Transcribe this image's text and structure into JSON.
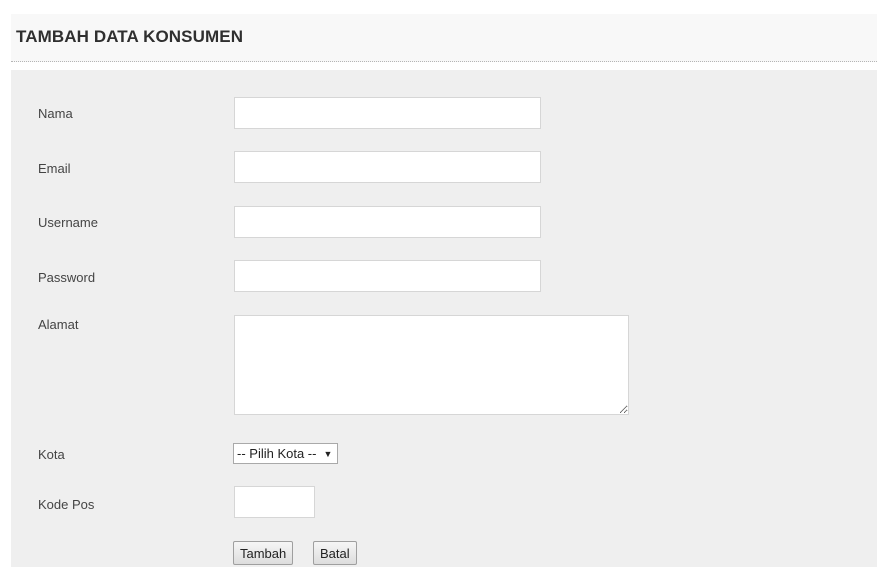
{
  "header": {
    "title": "TAMBAH DATA KONSUMEN"
  },
  "form": {
    "nama_label": "Nama",
    "nama_value": "",
    "email_label": "Email",
    "email_value": "",
    "username_label": "Username",
    "username_value": "",
    "password_label": "Password",
    "password_value": "",
    "alamat_label": "Alamat",
    "alamat_value": "",
    "kota_label": "Kota",
    "kota_selected": "-- Pilih Kota --",
    "kode_pos_label": "Kode Pos",
    "kode_pos_value": ""
  },
  "buttons": {
    "submit_label": "Tambah",
    "cancel_label": "Batal"
  },
  "icons": {
    "select_arrow": "caret-down-icon",
    "resize_handle": "resize-grip-icon"
  },
  "colors": {
    "panel_background": "#efefef",
    "header_background": "#f8f8f8"
  }
}
